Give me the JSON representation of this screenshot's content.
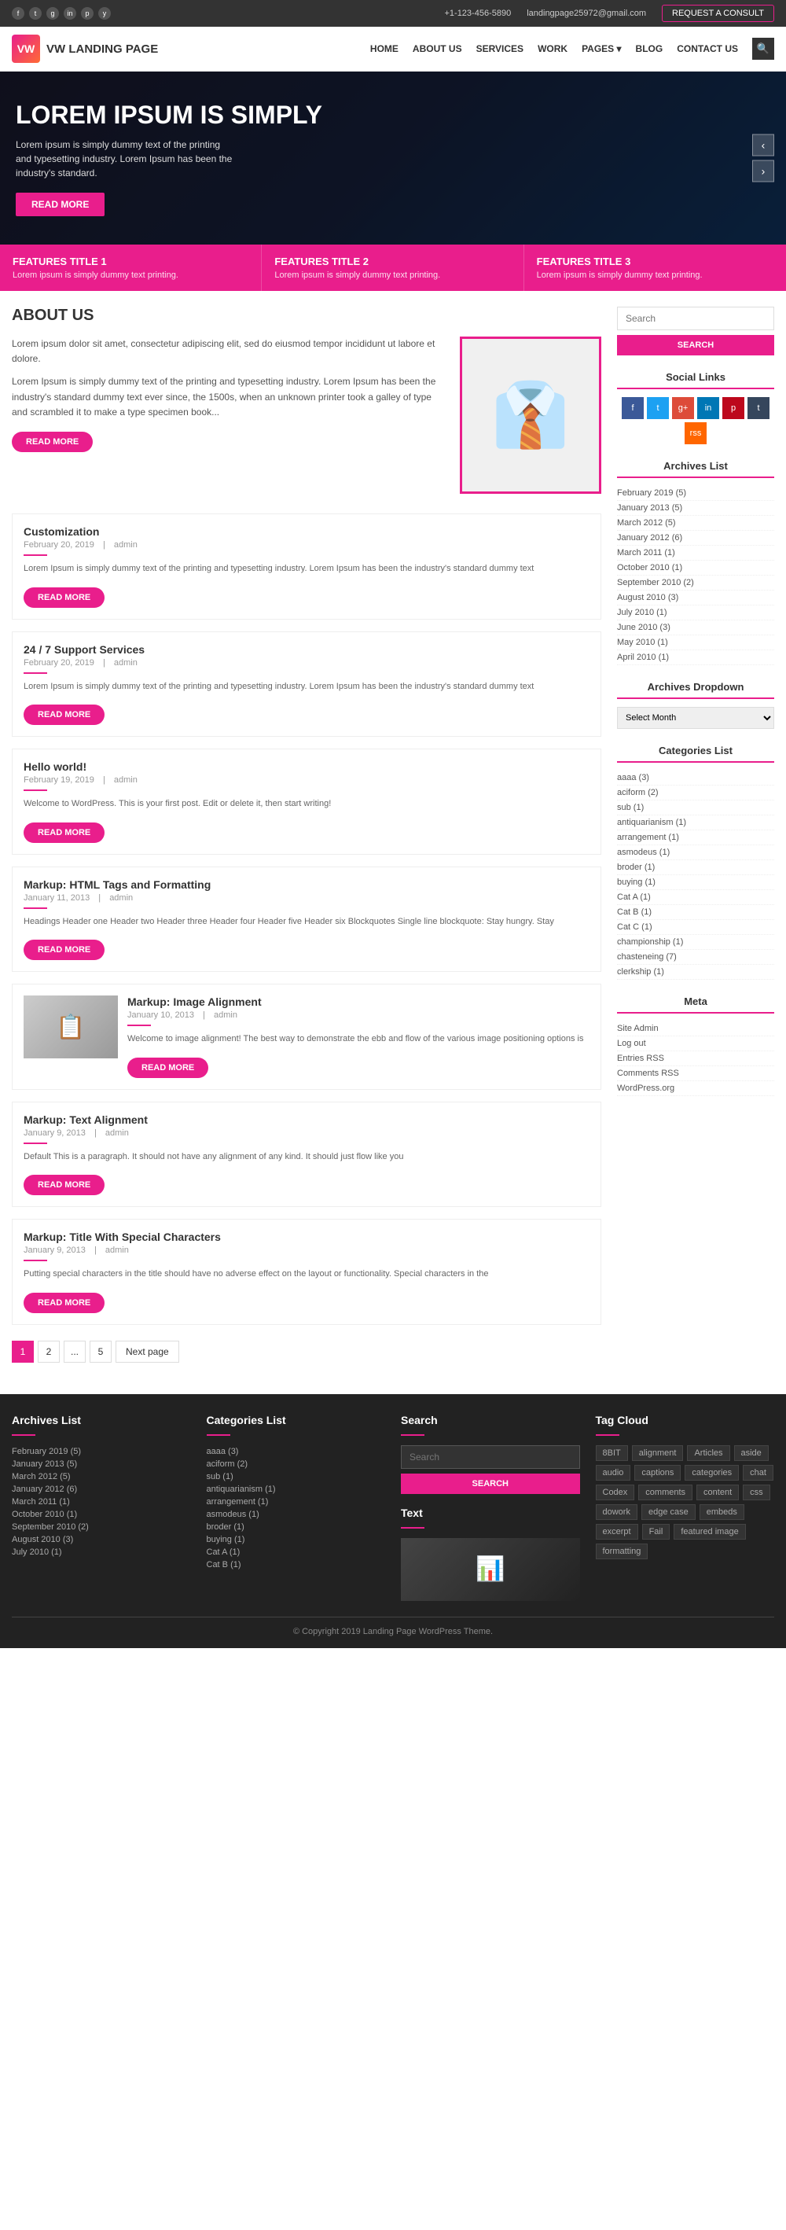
{
  "topbar": {
    "phone": "+1-123-456-5890",
    "email": "landingpage25972@gmail.com",
    "request_btn": "REQUEST A CONSULT",
    "socials": [
      "f",
      "t",
      "g",
      "in",
      "p",
      "y"
    ]
  },
  "header": {
    "logo_text": "VW LANDING PAGE",
    "nav": [
      {
        "label": "HOME"
      },
      {
        "label": "ABOUT US"
      },
      {
        "label": "SERVICES"
      },
      {
        "label": "WORK"
      },
      {
        "label": "PAGES"
      },
      {
        "label": "BLOG"
      },
      {
        "label": "CONTACT US"
      }
    ]
  },
  "hero": {
    "title": "LOREM IPSUM IS SIMPLY",
    "subtitle": "Lorem ipsum is simply dummy text of the printing and typesetting industry. Lorem Ipsum has been the industry's standard.",
    "btn": "READ MORE"
  },
  "features": [
    {
      "title": "FEATURES TITLE 1",
      "desc": "Lorem ipsum is simply dummy text printing."
    },
    {
      "title": "FEATURES TITLE 2",
      "desc": "Lorem ipsum is simply dummy text printing."
    },
    {
      "title": "FEATURES TITLE 3",
      "desc": "Lorem ipsum is simply dummy text printing."
    }
  ],
  "about": {
    "title": "ABOUT US",
    "para1": "Lorem ipsum dolor sit amet, consectetur adipiscing elit, sed do eiusmod tempor incididunt ut labore et dolore.",
    "para2": "Lorem Ipsum is simply dummy text of the printing and typesetting industry. Lorem Ipsum has been the industry's standard dummy text ever since, the 1500s, when an unknown printer took a galley of type and scrambled it to make a type specimen book...",
    "btn": "READ MORE"
  },
  "posts": [
    {
      "title": "Customization",
      "date": "February 20, 2019",
      "author": "admin",
      "excerpt": "Lorem Ipsum is simply dummy text of the printing and typesetting industry. Lorem Ipsum has been the industry's standard dummy text",
      "btn": "READ MORE",
      "has_image": false
    },
    {
      "title": "24 / 7 Support Services",
      "date": "February 20, 2019",
      "author": "admin",
      "excerpt": "Lorem Ipsum is simply dummy text of the printing and typesetting industry. Lorem Ipsum has been the industry's standard dummy text",
      "btn": "READ MORE",
      "has_image": false
    },
    {
      "title": "Hello world!",
      "date": "February 19, 2019",
      "author": "admin",
      "excerpt": "Welcome to WordPress. This is your first post. Edit or delete it, then start writing!",
      "btn": "READ MORE",
      "has_image": false
    },
    {
      "title": "Markup: HTML Tags and Formatting",
      "date": "January 11, 2013",
      "author": "admin",
      "excerpt": "Headings Header one Header two Header three Header four Header five Header six Blockquotes Single line blockquote: Stay hungry. Stay",
      "btn": "READ MORE",
      "has_image": false
    },
    {
      "title": "Markup: Image Alignment",
      "date": "January 10, 2013",
      "author": "admin",
      "excerpt": "Welcome to image alignment! The best way to demonstrate the ebb and flow of the various image positioning options is",
      "btn": "READ MORE",
      "has_image": true
    },
    {
      "title": "Markup: Text Alignment",
      "date": "January 9, 2013",
      "author": "admin",
      "excerpt": "Default This is a paragraph. It should not have any alignment of any kind. It should just flow like you",
      "btn": "READ MORE",
      "has_image": false
    },
    {
      "title": "Markup: Title With Special Characters",
      "date": "January 9, 2013",
      "author": "admin",
      "excerpt": "Putting special characters in the title should have no adverse effect on the layout or functionality. Special characters in the",
      "btn": "READ MORE",
      "has_image": false
    }
  ],
  "pagination": {
    "pages": [
      "1",
      "2",
      "...",
      "5"
    ],
    "next": "Next page"
  },
  "sidebar": {
    "search_placeholder": "Search",
    "search_btn": "SEARCH",
    "social_title": "Social Links",
    "archives_title": "Archives List",
    "archives": [
      "February 2019 (5)",
      "January 2013 (5)",
      "March 2012 (5)",
      "January 2012 (6)",
      "March 2011 (1)",
      "October 2010 (1)",
      "September 2010 (2)",
      "August 2010 (3)",
      "July 2010 (1)",
      "June 2010 (3)",
      "May 2010 (1)",
      "April 2010 (1)"
    ],
    "archives_dropdown_title": "Archives Dropdown",
    "archives_dropdown_placeholder": "Select Month",
    "categories_title": "Categories List",
    "categories": [
      "aaaa (3)",
      "aciform (2)",
      "sub (1)",
      "antiquarianism (1)",
      "arrangement (1)",
      "asmodeus (1)",
      "broder (1)",
      "buying (1)",
      "Cat A (1)",
      "Cat B (1)",
      "Cat C (1)",
      "championship (1)",
      "chasteneing (7)",
      "clerkship (1)"
    ],
    "meta_title": "Meta",
    "meta": [
      "Site Admin",
      "Log out",
      "Entries RSS",
      "Comments RSS",
      "WordPress.org"
    ]
  },
  "footer": {
    "archives_title": "Archives List",
    "archives": [
      "February 2019 (5)",
      "January 2013 (5)",
      "March 2012 (5)",
      "January 2012 (6)",
      "March 2011 (1)",
      "October 2010 (1)",
      "September 2010 (2)",
      "August 2010 (3)",
      "July 2010 (1)"
    ],
    "categories_title": "Categories List",
    "categories": [
      "aaaa (3)",
      "aciform (2)",
      "sub (1)",
      "antiquarianism (1)",
      "arrangement (1)",
      "asmodeus (1)",
      "broder (1)",
      "buying (1)",
      "Cat A (1)",
      "Cat B (1)"
    ],
    "search_title": "Search",
    "search_placeholder": "Search",
    "search_btn": "SEARCH",
    "text_title": "Text",
    "tag_title": "Tag Cloud",
    "tags": [
      "8BIT",
      "alignment",
      "Articles",
      "aside",
      "audio",
      "captions",
      "categories",
      "chat",
      "Codex",
      "comments",
      "content",
      "css",
      "dowork",
      "edge case",
      "embeds",
      "excerpt",
      "Fail",
      "featured image",
      "formatting"
    ],
    "copyright": "© Copyright 2019 Landing Page WordPress Theme."
  }
}
